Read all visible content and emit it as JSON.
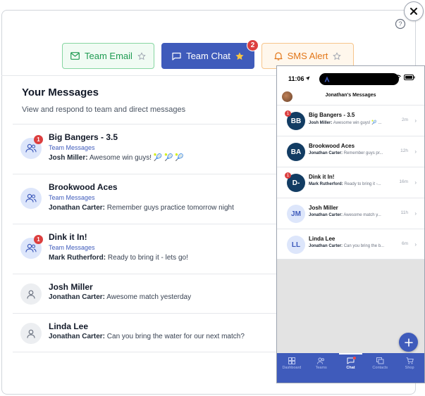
{
  "tabs": [
    {
      "label": "Team Email",
      "icon": "mail-icon",
      "color": "#1f9b52",
      "starred": false
    },
    {
      "label": "Team Chat",
      "icon": "chat-icon",
      "color": "#3f5bbb",
      "starred": true,
      "badge": "2"
    },
    {
      "label": "SMS Alert",
      "icon": "bell-icon",
      "color": "#e27618",
      "starred": false
    }
  ],
  "messages_panel": {
    "title": "Your Messages",
    "subtitle": "View and respond to team and direct messages",
    "conversations": [
      {
        "name": "Big Bangers - 3.5",
        "type": "Team Messages",
        "sender": "Josh Miller:",
        "text": "Awesome win guys! 🎾 🎾 🎾",
        "badge": "1",
        "kind": "team"
      },
      {
        "name": "Brookwood Aces",
        "type": "Team Messages",
        "sender": "Jonathan Carter:",
        "text": "Remember guys practice tomorrow night",
        "badge": "",
        "kind": "team"
      },
      {
        "name": "Dink it In!",
        "type": "Team Messages",
        "sender": "Mark Rutherford:",
        "text": "Ready to bring it - lets go!",
        "badge": "1",
        "kind": "team"
      },
      {
        "name": "Josh Miller",
        "type": "",
        "sender": "Jonathan Carter:",
        "text": "Awesome match yesterday",
        "badge": "",
        "kind": "person"
      },
      {
        "name": "Linda Lee",
        "type": "",
        "sender": "Jonathan Carter:",
        "text": "Can you bring the water for our next match?",
        "badge": "",
        "kind": "person"
      }
    ]
  },
  "phone": {
    "time": "11:06",
    "header_title": "Jonathan's Messages",
    "conversations": [
      {
        "initials": "BB",
        "name": "Big Bangers - 3.5",
        "sender": "Josh Miller:",
        "text": "Awesome win guys! 🎾 ...",
        "time": "2m",
        "badge": "1",
        "bg": "#123c63",
        "fg": "#ffffff"
      },
      {
        "initials": "BA",
        "name": "Brookwood Aces",
        "sender": "Jonathan Carter:",
        "text": "Remember guys pr...",
        "time": "12h",
        "badge": "",
        "bg": "#123c63",
        "fg": "#ffffff"
      },
      {
        "initials": "D-",
        "name": "Dink it In!",
        "sender": "Mark Rutherford:",
        "text": "Ready to bring it -...",
        "time": "16m",
        "badge": "1",
        "bg": "#123c63",
        "fg": "#ffffff"
      },
      {
        "initials": "JM",
        "name": "Josh Miller",
        "sender": "Jonathan Carter:",
        "text": "Awesome match y...",
        "time": "11h",
        "badge": "",
        "bg": "#dde6fb",
        "fg": "#3f5bbb"
      },
      {
        "initials": "LL",
        "name": "Linda Lee",
        "sender": "Jonathan Carter:",
        "text": "Can you bring the b...",
        "time": "6m",
        "badge": "",
        "bg": "#dde6fb",
        "fg": "#3f5bbb"
      }
    ],
    "tabbar": [
      {
        "label": "Dashboard",
        "icon": "dashboard-icon",
        "active": false
      },
      {
        "label": "Teams",
        "icon": "teams-icon",
        "active": false
      },
      {
        "label": "Chat",
        "icon": "chat-icon",
        "active": true
      },
      {
        "label": "Contacts",
        "icon": "contacts-icon",
        "active": false
      },
      {
        "label": "Shop",
        "icon": "cart-icon",
        "active": false
      }
    ]
  }
}
